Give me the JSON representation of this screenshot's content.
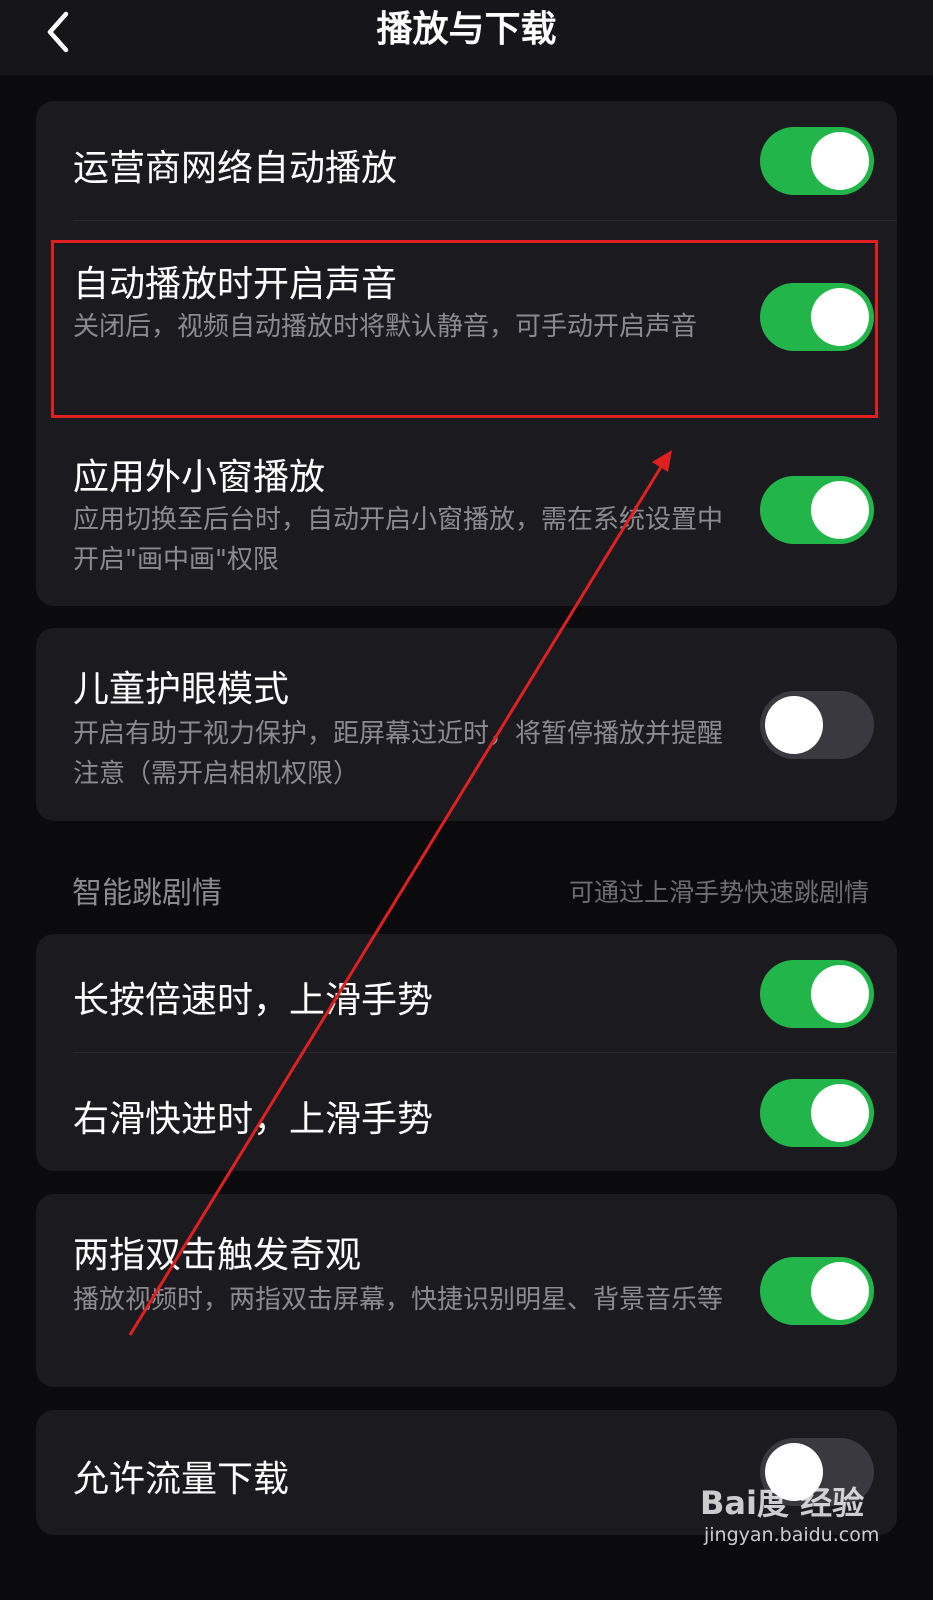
{
  "header": {
    "title": "播放与下载",
    "back_icon": "chevron-left-icon"
  },
  "colors": {
    "toggle_on": "#22b64a",
    "toggle_off": "#39393f",
    "highlight": "#e02020"
  },
  "group1": {
    "rows": [
      {
        "title": "运营商网络自动播放",
        "desc": "",
        "enabled": true
      },
      {
        "title": "自动播放时开启声音",
        "desc": "关闭后，视频自动播放时将默认静音，可手动开启声音",
        "enabled": true
      },
      {
        "title": "应用外小窗播放",
        "desc": "应用切换至后台时，自动开启小窗播放，需在系统设置中开启\"画中画\"权限",
        "enabled": true
      }
    ]
  },
  "group2": {
    "rows": [
      {
        "title": "儿童护眼模式",
        "desc": "开启有助于视力保护，距屏幕过近时，将暂停播放并提醒注意（需开启相机权限）",
        "enabled": false
      }
    ]
  },
  "section": {
    "title": "智能跳剧情",
    "hint": "可通过上滑手势快速跳剧情"
  },
  "group3": {
    "rows": [
      {
        "title": "长按倍速时，上滑手势",
        "enabled": true
      },
      {
        "title": "右滑快进时，上滑手势",
        "enabled": true
      }
    ]
  },
  "group4": {
    "rows": [
      {
        "title": "两指双击触发奇观",
        "desc": "播放视频时，两指双击屏幕，快捷识别明星、背景音乐等",
        "enabled": true
      }
    ]
  },
  "group5": {
    "rows": [
      {
        "title": "允许流量下载",
        "enabled": false
      }
    ]
  },
  "watermark": {
    "logo": "Bai度 经验",
    "url": "jingyan.baidu.com"
  }
}
